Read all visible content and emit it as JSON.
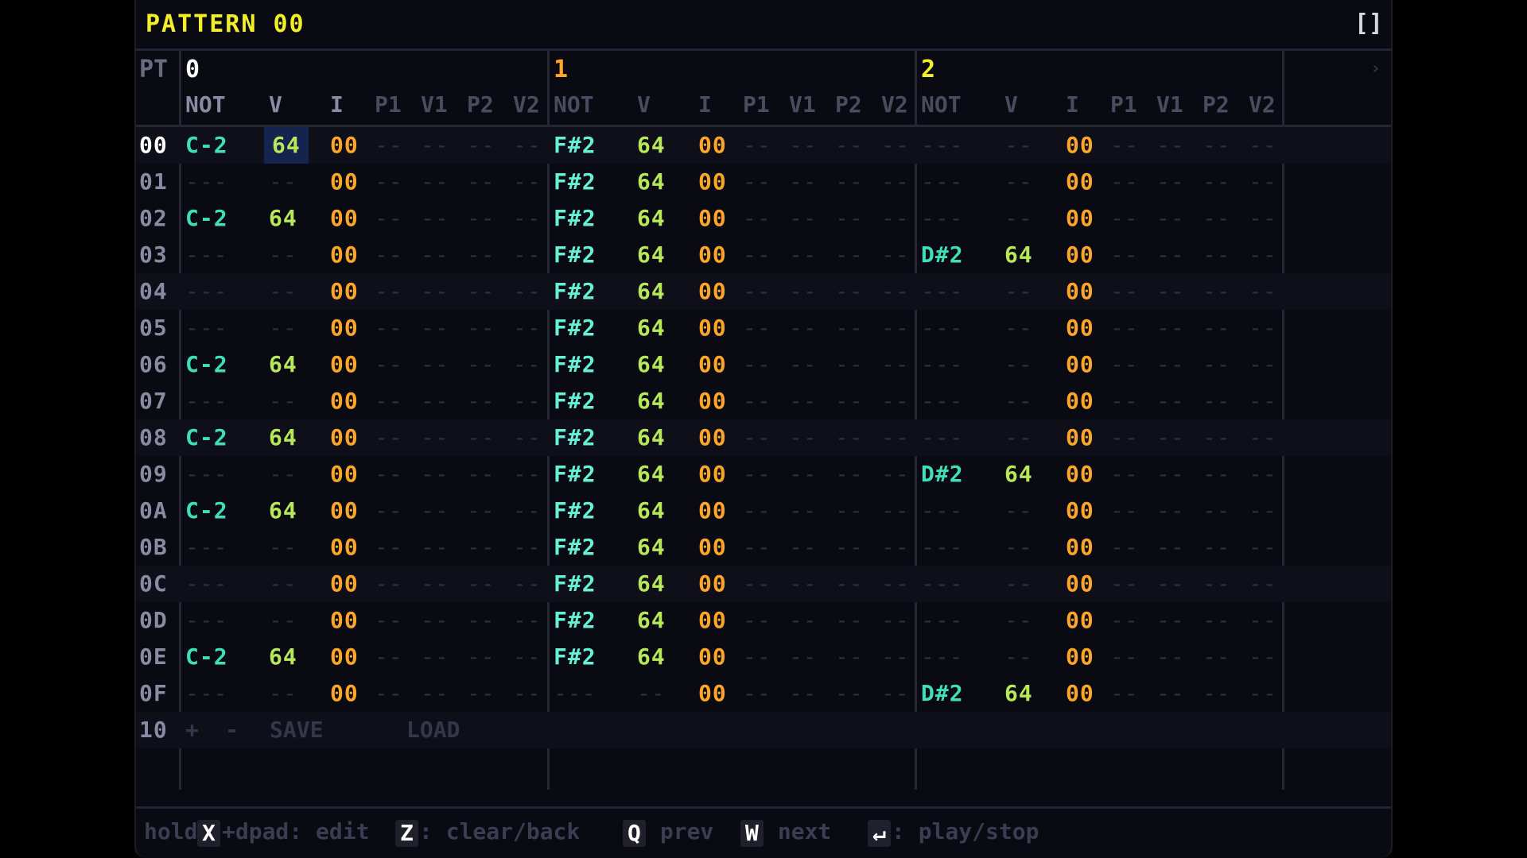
{
  "title": "PATTERN 00",
  "fullscreen_label": "[]",
  "pt_label": "PT",
  "scroll_glyph": "›",
  "channels": [
    {
      "label": "0",
      "color": "#ffffff"
    },
    {
      "label": "1",
      "color": "#ffa62a"
    },
    {
      "label": "2",
      "color": "#f2ef28"
    }
  ],
  "columns": [
    "NOT",
    "V",
    "I",
    "P1",
    "V1",
    "P2",
    "V2"
  ],
  "row_numbers": [
    "00",
    "01",
    "02",
    "03",
    "04",
    "05",
    "06",
    "07",
    "08",
    "09",
    "0A",
    "0B",
    "0C",
    "0D",
    "0E",
    "0F"
  ],
  "empty_note": "---",
  "empty_short": "--",
  "rows": [
    [
      [
        "C-2",
        "64",
        "00"
      ],
      [
        "F#2",
        "64",
        "00"
      ],
      [
        "",
        "",
        "00"
      ]
    ],
    [
      [
        "",
        "",
        "00"
      ],
      [
        "F#2",
        "64",
        "00"
      ],
      [
        "",
        "",
        "00"
      ]
    ],
    [
      [
        "C-2",
        "64",
        "00"
      ],
      [
        "F#2",
        "64",
        "00"
      ],
      [
        "",
        "",
        "00"
      ]
    ],
    [
      [
        "",
        "",
        "00"
      ],
      [
        "F#2",
        "64",
        "00"
      ],
      [
        "D#2",
        "64",
        "00"
      ]
    ],
    [
      [
        "",
        "",
        "00"
      ],
      [
        "F#2",
        "64",
        "00"
      ],
      [
        "",
        "",
        "00"
      ]
    ],
    [
      [
        "",
        "",
        "00"
      ],
      [
        "F#2",
        "64",
        "00"
      ],
      [
        "",
        "",
        "00"
      ]
    ],
    [
      [
        "C-2",
        "64",
        "00"
      ],
      [
        "F#2",
        "64",
        "00"
      ],
      [
        "",
        "",
        "00"
      ]
    ],
    [
      [
        "",
        "",
        "00"
      ],
      [
        "F#2",
        "64",
        "00"
      ],
      [
        "",
        "",
        "00"
      ]
    ],
    [
      [
        "C-2",
        "64",
        "00"
      ],
      [
        "F#2",
        "64",
        "00"
      ],
      [
        "",
        "",
        "00"
      ]
    ],
    [
      [
        "",
        "",
        "00"
      ],
      [
        "F#2",
        "64",
        "00"
      ],
      [
        "D#2",
        "64",
        "00"
      ]
    ],
    [
      [
        "C-2",
        "64",
        "00"
      ],
      [
        "F#2",
        "64",
        "00"
      ],
      [
        "",
        "",
        "00"
      ]
    ],
    [
      [
        "",
        "",
        "00"
      ],
      [
        "F#2",
        "64",
        "00"
      ],
      [
        "",
        "",
        "00"
      ]
    ],
    [
      [
        "",
        "",
        "00"
      ],
      [
        "F#2",
        "64",
        "00"
      ],
      [
        "",
        "",
        "00"
      ]
    ],
    [
      [
        "",
        "",
        "00"
      ],
      [
        "F#2",
        "64",
        "00"
      ],
      [
        "",
        "",
        "00"
      ]
    ],
    [
      [
        "C-2",
        "64",
        "00"
      ],
      [
        "F#2",
        "64",
        "00"
      ],
      [
        "",
        "",
        "00"
      ]
    ],
    [
      [
        "",
        "",
        "00"
      ],
      [
        "",
        "",
        "00"
      ],
      [
        "D#2",
        "64",
        "00"
      ]
    ]
  ],
  "cursor": {
    "row": 0,
    "channel": 0,
    "column": 1
  },
  "length_row": {
    "number": "10",
    "plus": "+",
    "minus": "-",
    "save": "SAVE",
    "load": "LOAD"
  },
  "footer": {
    "hold_text": "hold",
    "key_x": "X",
    "dpad_text": "+dpad: edit",
    "key_z": "Z",
    "clear_text": ": clear/back",
    "key_q": "Q",
    "prev_text": " prev",
    "key_w": "W",
    "next_text": " next",
    "key_enter": "↵",
    "play_text": ": play/stop"
  },
  "colors": {
    "title": "#f2ef28",
    "note": "#3fe0b7",
    "velocity": "#b7e85a",
    "instrument": "#ffa62a",
    "cursor_bg": "#15234f",
    "background": "#0a0a12"
  }
}
